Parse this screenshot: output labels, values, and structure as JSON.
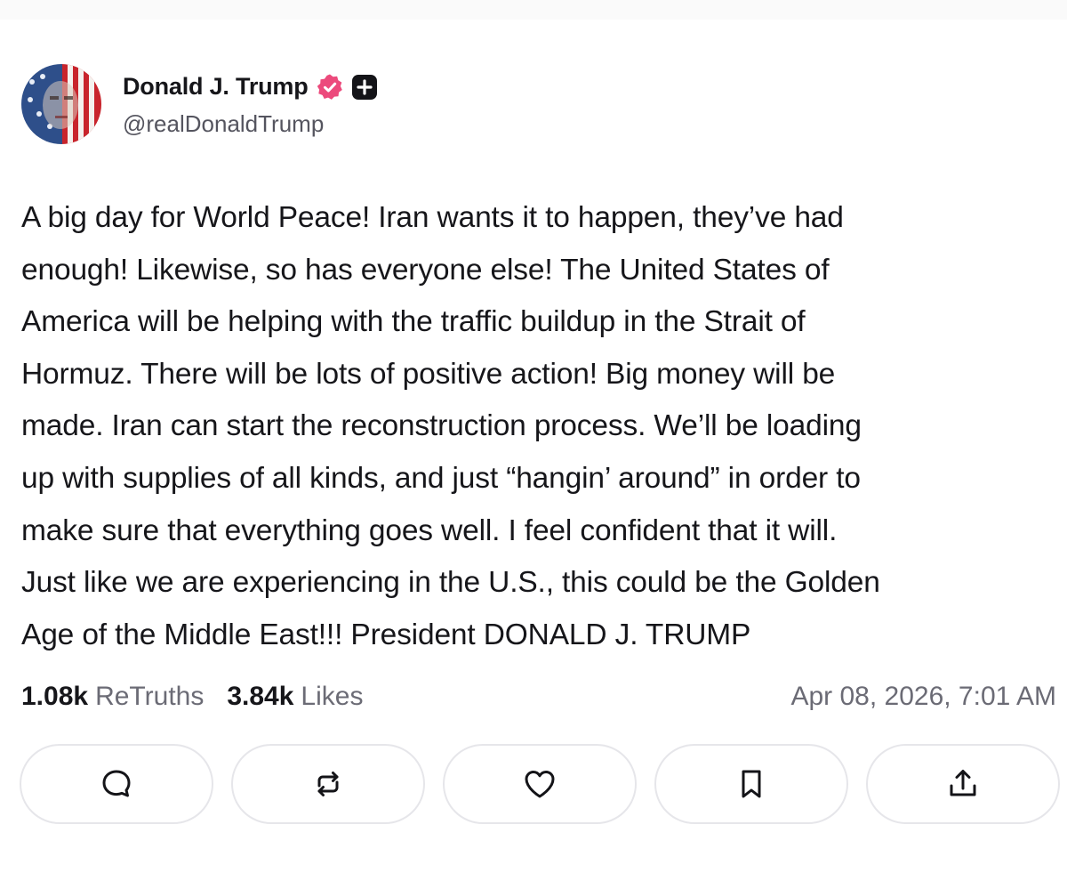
{
  "post": {
    "author": {
      "display_name": "Donald J. Trump",
      "handle": "@realDonaldTrump",
      "avatar_icon": "flag-portrait-avatar",
      "badges": [
        "verified-badge-icon",
        "plus-badge-icon"
      ]
    },
    "body_lines": [
      "A big day for World Peace! Iran wants it to happen, they’ve had",
      "enough! Likewise, so has everyone else! The United States of",
      "America will be helping with the traffic buildup in the Strait of",
      "Hormuz. There will be lots of positive action! Big money will be",
      "made. Iran can start the reconstruction process. We’ll be loading",
      "up with supplies of all kinds, and just “hangin’ around” in order to",
      "make sure that everything goes well. I feel confident that it will.",
      "Just like we are experiencing in the U.S., this could be the Golden",
      "Age of the Middle East!!! President DONALD J. TRUMP"
    ],
    "stats": {
      "retruths_count": "1.08k",
      "retruths_label": "ReTruths",
      "likes_count": "3.84k",
      "likes_label": "Likes"
    },
    "timestamp": "Apr 08, 2026, 7:01 AM",
    "actions": [
      "reply-icon",
      "retruth-icon",
      "like-icon",
      "bookmark-icon",
      "share-icon"
    ]
  },
  "colors": {
    "verified_badge": "#ec4a7c",
    "text_primary": "#16161a",
    "text_secondary": "#6b6b75",
    "button_border": "#e6e6ea"
  }
}
